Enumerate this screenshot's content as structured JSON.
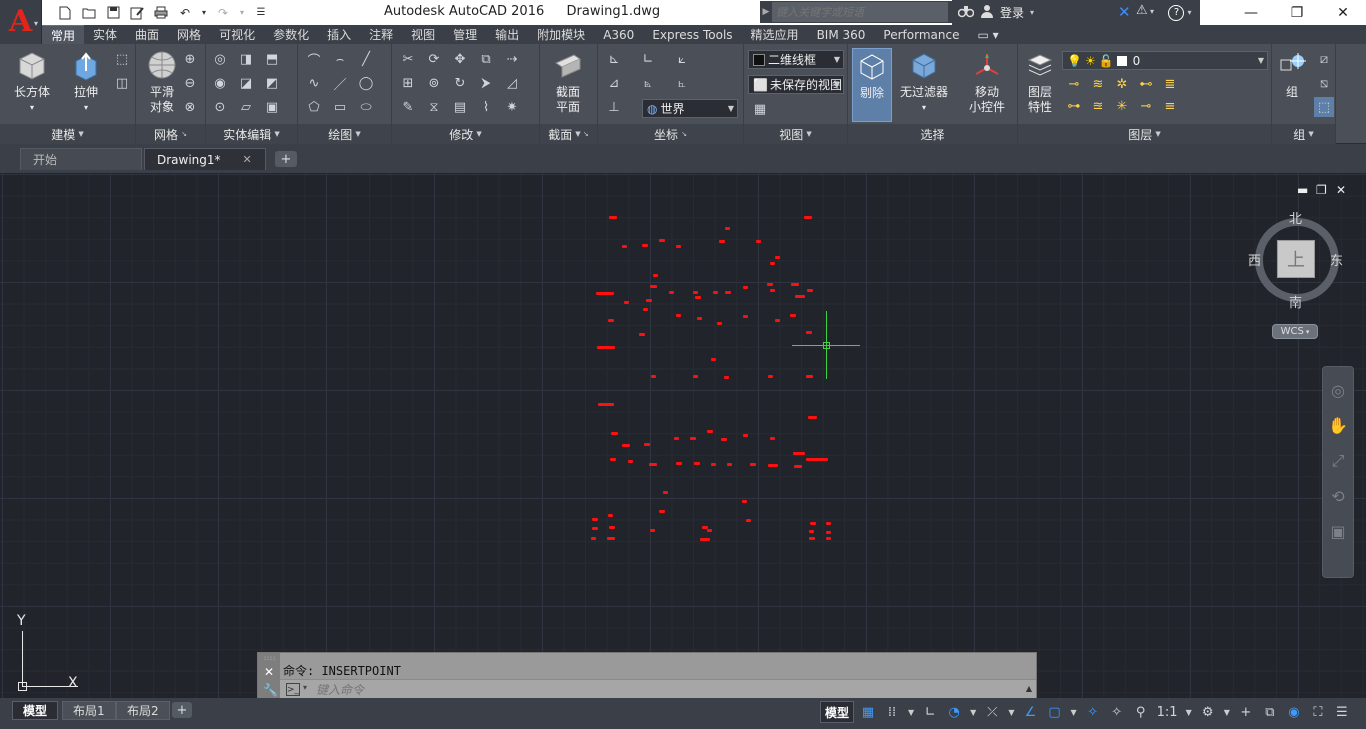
{
  "title_bar": {
    "app_name": "Autodesk AutoCAD 2016",
    "file_name": "Drawing1.dwg",
    "search_placeholder": "键入关键字或短语",
    "login_label": "登录"
  },
  "ribbon_tabs": [
    "常用",
    "实体",
    "曲面",
    "网格",
    "可视化",
    "参数化",
    "插入",
    "注释",
    "视图",
    "管理",
    "输出",
    "附加模块",
    "A360",
    "Express Tools",
    "精选应用",
    "BIM 360",
    "Performance"
  ],
  "active_ribbon_tab": "常用",
  "panels": {
    "modeling": {
      "title": "建模",
      "box_label": "长方体",
      "extrude_label": "拉伸"
    },
    "mesh": {
      "title": "网格",
      "smooth_label_1": "平滑",
      "smooth_label_2": "对象"
    },
    "solid_edit": {
      "title": "实体编辑"
    },
    "draw": {
      "title": "绘图"
    },
    "modify": {
      "title": "修改"
    },
    "section": {
      "title": "截面",
      "plane_label_1": "截面",
      "plane_label_2": "平面"
    },
    "coordinates": {
      "title": "坐标",
      "ucs_value": "世界"
    },
    "view": {
      "title": "视图",
      "visual_style": "二维线框",
      "saved_view": "未保存的视图"
    },
    "selection": {
      "title": "选择",
      "cull_label": "剔除",
      "filter_label": "无过滤器",
      "gizmo_label_1": "移动",
      "gizmo_label_2": "小控件"
    },
    "layers": {
      "title": "图层",
      "props_label_1": "图层",
      "props_label_2": "特性",
      "current_layer": "0"
    },
    "groups": {
      "title": "组",
      "group_label": "组"
    }
  },
  "doc_tabs": [
    {
      "label": "开始"
    },
    {
      "label": "Drawing1*"
    }
  ],
  "viewcube": {
    "north": "北",
    "south": "南",
    "east": "东",
    "west": "西",
    "face": "上",
    "wcs": "WCS"
  },
  "ucs_icon": {
    "x_label": "X",
    "y_label": "Y"
  },
  "command_line": {
    "history": "命令: INSERTPOINT",
    "placeholder": "键入命令"
  },
  "layout_tabs": [
    "模型",
    "布局1",
    "布局2"
  ],
  "status_bar": {
    "model_label": "模型",
    "scale": "1:1"
  },
  "colors": {
    "accent": "#3d9bff",
    "points": "#ff1010",
    "crosshair": "#3fd23f",
    "background": "#21252b"
  }
}
